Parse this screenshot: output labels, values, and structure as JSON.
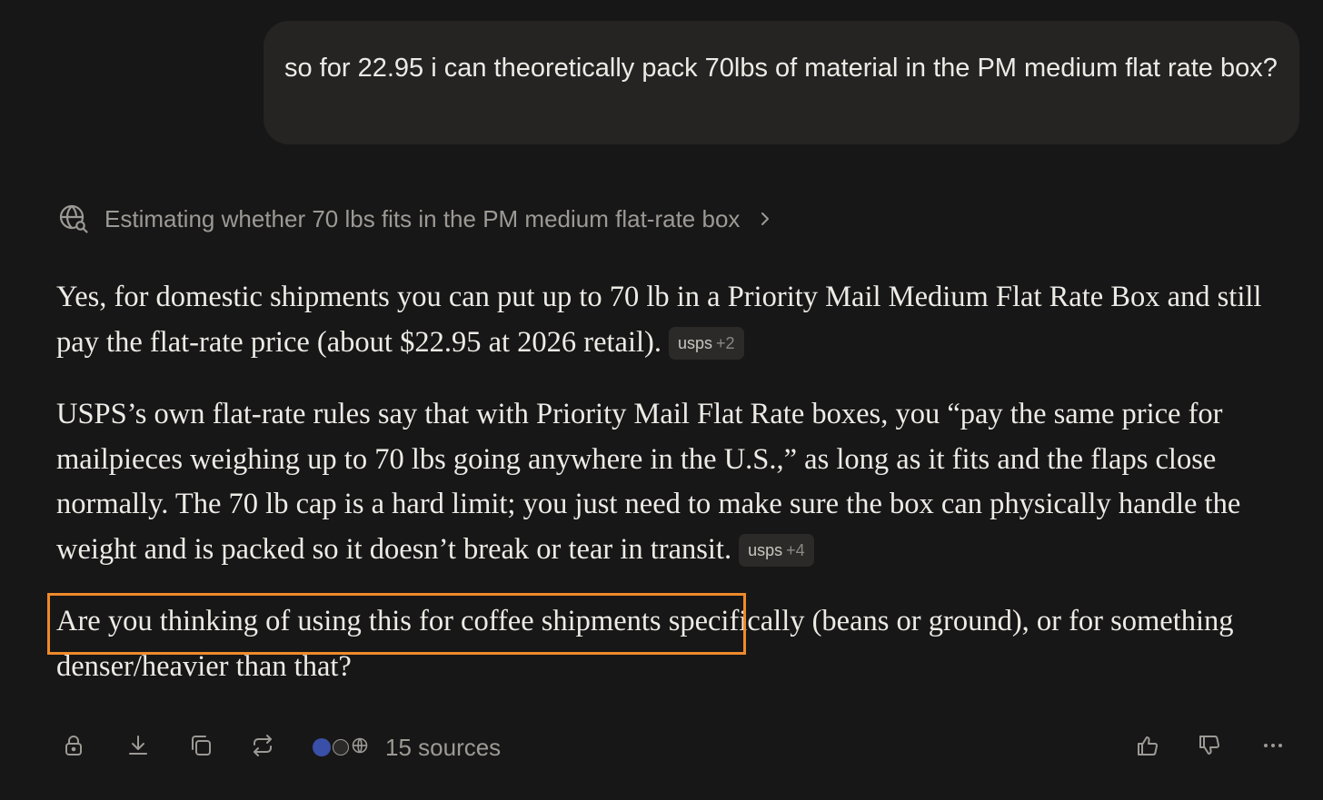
{
  "user_message": {
    "text": "so for 22.95 i can theoretically pack 70lbs of material in the PM medium flat rate box?"
  },
  "thinking": {
    "label": "Estimating whether 70 lbs fits in the PM medium flat-rate box",
    "icon": "globe-search-icon"
  },
  "answer": {
    "p1": "Yes, for domestic shipments you can put up to 70 lb in a Priority Mail Medium Flat Rate Box and still pay the flat-rate price (about $22.95 at 2026 retail).",
    "p1_cite": {
      "source": "usps",
      "more": "+2"
    },
    "p2": "USPS’s own flat-rate rules say that with Priority Mail Flat Rate boxes, you “pay the same price for mailpieces weighing up to 70 lbs going anywhere in the U.S.,” as long as it fits and the flaps close normally. The 70 lb cap is a hard limit; you just need to make sure the box can physically handle the weight and is packed so it doesn’t break or tear in transit.",
    "p2_cite": {
      "source": "usps",
      "more": "+4"
    },
    "p3_highlighted": "Are you thinking of using this for coffee shipments",
    "p3_rest": " specifically (beans or ground), or for something denser/heavier than that?"
  },
  "toolbar": {
    "sources_label": "15 sources",
    "icons": [
      "lock-icon",
      "download-icon",
      "copy-icon",
      "regenerate-icon",
      "thumbs-up-icon",
      "thumbs-down-icon",
      "more-icon"
    ]
  },
  "colors": {
    "background": "#181717",
    "bubble": "#252423",
    "text": "#ecebe6",
    "muted": "#9c9a95",
    "highlight": "#ee8a2a"
  }
}
